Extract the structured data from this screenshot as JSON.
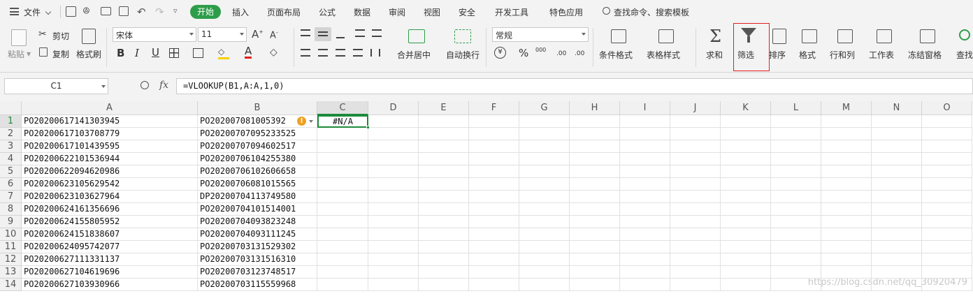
{
  "menu": {
    "file_label": "文件",
    "tabs": [
      "开始",
      "插入",
      "页面布局",
      "公式",
      "数据",
      "审阅",
      "视图",
      "安全",
      "开发工具",
      "特色应用"
    ],
    "search_label": "查找命令、搜索模板"
  },
  "ribbon": {
    "paste": "粘贴",
    "cut": "剪切",
    "copy": "复制",
    "format_painter": "格式刷",
    "font_name": "宋体",
    "font_size": "11",
    "bold": "B",
    "italic": "I",
    "underline": "U",
    "font_color_letter": "A",
    "merge_center": "合并居中",
    "wrap_text": "自动换行",
    "number_format": "常规",
    "currency": "¥",
    "percent": "%",
    "thousands": "000",
    "inc_decimal": ".00",
    "dec_decimal": ".00",
    "cond_format": "条件格式",
    "table_style": "表格样式",
    "sum": "求和",
    "filter": "筛选",
    "sort": "排序",
    "format": "格式",
    "row_col": "行和列",
    "worksheet": "工作表",
    "freeze": "冻结窗格",
    "find": "查找",
    "highlight_color": "#e02020"
  },
  "formula_bar": {
    "cell_ref": "C1",
    "fx": "fx",
    "formula": "=VLOOKUP(B1,A:A,1,0)"
  },
  "columns": [
    "A",
    "B",
    "C",
    "D",
    "E",
    "F",
    "G",
    "H",
    "I",
    "J",
    "K",
    "L",
    "M",
    "N",
    "O"
  ],
  "rows": [
    {
      "n": "1",
      "a": "PO20200617141303945",
      "b": "PO202007081005392",
      "c": "#N/A"
    },
    {
      "n": "2",
      "a": "PO20200617103708779",
      "b": "PO20200707095233525",
      "c": ""
    },
    {
      "n": "3",
      "a": "PO20200617101439595",
      "b": "PO20200707094602517",
      "c": ""
    },
    {
      "n": "4",
      "a": "PO20200622101536944",
      "b": "PO20200706104255380",
      "c": ""
    },
    {
      "n": "5",
      "a": "PO20200622094620986",
      "b": "PO20200706102606658",
      "c": ""
    },
    {
      "n": "6",
      "a": "PO20200623105629542",
      "b": "PO20200706081015565",
      "c": ""
    },
    {
      "n": "7",
      "a": "PO20200623103627964",
      "b": "DP20200704113749580",
      "c": ""
    },
    {
      "n": "8",
      "a": "PO20200624161356696",
      "b": "PO20200704101514001",
      "c": ""
    },
    {
      "n": "9",
      "a": "PO20200624155805952",
      "b": "PO20200704093823248",
      "c": ""
    },
    {
      "n": "10",
      "a": "PO20200624151838607",
      "b": "PO20200704093111245",
      "c": ""
    },
    {
      "n": "11",
      "a": "PO20200624095742077",
      "b": "PO20200703131529302",
      "c": ""
    },
    {
      "n": "12",
      "a": "PO20200627111331137",
      "b": "PO20200703131516310",
      "c": ""
    },
    {
      "n": "13",
      "a": "PO20200627104619696",
      "b": "PO20200703123748517",
      "c": ""
    },
    {
      "n": "14",
      "a": "PO20200627103930966",
      "b": "PO20200703115559968",
      "c": ""
    }
  ],
  "watermark": "https://blog.csdn.net/qq_30920479",
  "colors": {
    "active_tab": "#2e9d4a",
    "selection": "#1e8a3c",
    "warning": "#f0a020"
  }
}
